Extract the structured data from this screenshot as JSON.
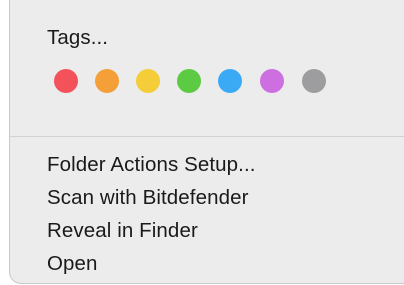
{
  "context_menu": {
    "tags_label": "Tags...",
    "tag_colors": [
      {
        "name": "red",
        "color": "#f4525a"
      },
      {
        "name": "orange",
        "color": "#f59f39"
      },
      {
        "name": "yellow",
        "color": "#f4cd39"
      },
      {
        "name": "green",
        "color": "#5ccb43"
      },
      {
        "name": "blue",
        "color": "#3aaaf5"
      },
      {
        "name": "purple",
        "color": "#cd6fe0"
      },
      {
        "name": "gray",
        "color": "#9d9d9f"
      }
    ],
    "items": [
      {
        "label": "Folder Actions Setup..."
      },
      {
        "label": "Scan with Bitdefender"
      },
      {
        "label": "Reveal in Finder"
      },
      {
        "label": "Open"
      }
    ]
  }
}
